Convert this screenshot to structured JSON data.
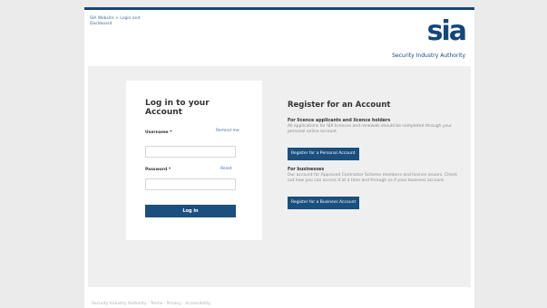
{
  "breadcrumb": {
    "line1": "SIA Website  >  Login and",
    "line2": "Dashboard"
  },
  "logo": {
    "mark": "sia",
    "org": "Security Industry Authority"
  },
  "login": {
    "title": "Log in to your Account",
    "username_label": "Username *",
    "username_link": "Remind me",
    "username_value": "",
    "password_label": "Password *",
    "password_link": "Reset",
    "password_value": "",
    "login_button": "Log in"
  },
  "register": {
    "title": "Register for an Account",
    "personal": {
      "heading": "For licence applicants and licence holders",
      "text": "All applications for SIA licences and renewals should be completed through your personal online account.",
      "button": "Register for a Personal Account"
    },
    "business": {
      "heading": "For businesses",
      "text": "Our account for Approved Contractor Scheme members and licence issuers. Check out how you can access it at a time and through us if your business account.",
      "button": "Register for a Business Account"
    }
  },
  "footer": {
    "text": "Security Industry Authority · Terms · Privacy · Accessibility"
  }
}
